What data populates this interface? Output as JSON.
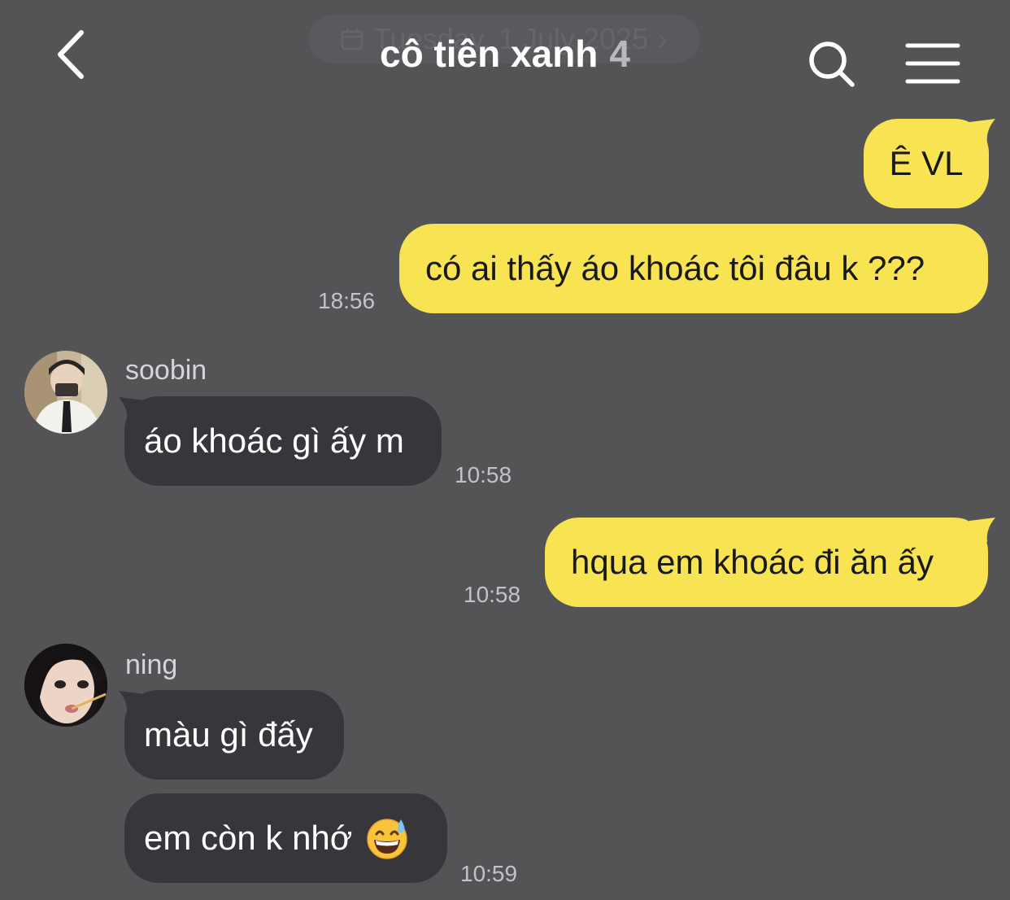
{
  "header": {
    "date_ghost": "Tuesday, 1 July 2025",
    "title": "cô tiên xanh",
    "member_count": "4"
  },
  "messages": [
    {
      "direction": "out",
      "text": "Ê VL"
    },
    {
      "direction": "out",
      "text": "có ai thấy áo khoác tôi đâu k ???",
      "time": "18:56"
    },
    {
      "direction": "in",
      "sender": "soobin",
      "text": "áo khoác gì ấy m",
      "time": "10:58"
    },
    {
      "direction": "out",
      "text": "hqua em khoác đi ăn ấy",
      "time": "10:58"
    },
    {
      "direction": "in",
      "sender": "ning",
      "text": "màu gì đấy"
    },
    {
      "direction": "in",
      "text": "em còn k nhớ",
      "emoji": "grinning-face-with-sweat",
      "time": "10:59"
    }
  ],
  "colors": {
    "background": "#545356",
    "outgoing_bubble": "#f8e452",
    "incoming_bubble": "#37363a"
  }
}
